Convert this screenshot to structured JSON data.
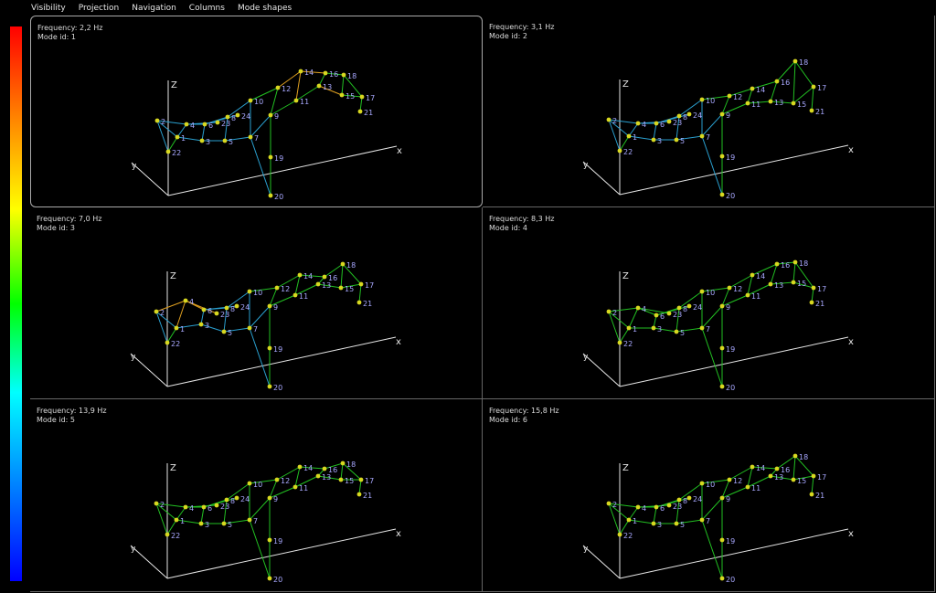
{
  "menu": [
    "Visibility",
    "Projection",
    "Navigation",
    "Columns",
    "Mode shapes"
  ],
  "axis_labels": {
    "z": "Z",
    "x": "x",
    "y": "y"
  },
  "views": [
    {
      "frequency": "Frequency: 2,2 Hz",
      "mode": "Mode id: 1",
      "selected": true
    },
    {
      "frequency": "Frequency: 3,1 Hz",
      "mode": "Mode id: 2",
      "selected": false
    },
    {
      "frequency": "Frequency: 7,0 Hz",
      "mode": "Mode id: 3",
      "selected": false
    },
    {
      "frequency": "Frequency: 8,3 Hz",
      "mode": "Mode id: 4",
      "selected": false
    },
    {
      "frequency": "Frequency: 13,9 Hz",
      "mode": "Mode id: 5",
      "selected": false
    },
    {
      "frequency": "Frequency: 15,8 Hz",
      "mode": "Mode id: 6",
      "selected": false
    }
  ],
  "node_ids": [
    "1",
    "2",
    "3",
    "4",
    "5",
    "6",
    "7",
    "8",
    "9",
    "10",
    "11",
    "12",
    "13",
    "14",
    "15",
    "16",
    "17",
    "18",
    "19",
    "20",
    "21",
    "22",
    "23",
    "24"
  ],
  "colors": {
    "background": "#000000",
    "axis": "#e6e6e6",
    "node": "#d8d820",
    "label": "#a8a8ff",
    "edge_low": "#22c022",
    "edge_mid": "#2aa0d0",
    "edge_high": "#e0a020"
  }
}
